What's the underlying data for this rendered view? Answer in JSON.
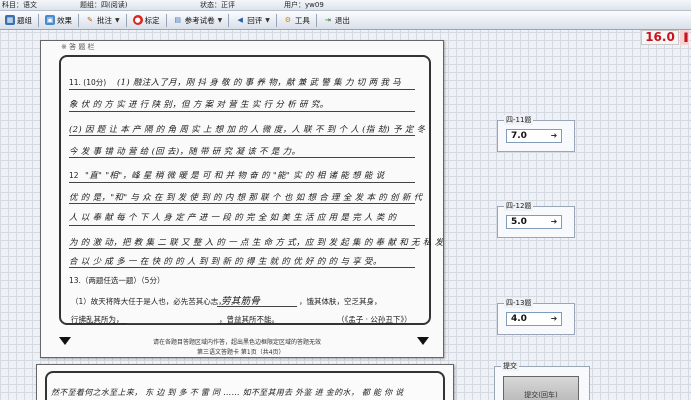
{
  "status_bar": {
    "subject": "科目：语文",
    "question_no": "题组：四(阅读)",
    "state": "状态：正评",
    "user": "用户：yw09"
  },
  "toolbar": {
    "items": [
      {
        "label": "题组",
        "icon": "grid-icon"
      },
      {
        "label": "效果",
        "icon": "image-icon"
      },
      {
        "label": "批注",
        "icon": "pen-icon"
      },
      {
        "label": "标定",
        "icon": "stop-icon"
      },
      {
        "label": "参考试卷",
        "icon": "document-icon"
      },
      {
        "label": "回评",
        "icon": "back-arrow-icon"
      },
      {
        "label": "工具",
        "icon": "tool-icon"
      },
      {
        "label": "退出",
        "icon": "exit-icon"
      }
    ]
  },
  "total_score": "16.0",
  "sheet": {
    "header": "※ 答 题 栏",
    "q11_label": "11. (10分)",
    "q12_label": "12",
    "q13_label": "13.（两题任选一题）（5分）",
    "q13_sub": "（1）故天将降大任于是人也，必先苦其心志，",
    "q13_sub2": "行拂乱其所为，",
    "q13_sub3": "，曾益其所不能。",
    "q13_cite": "（《孟子 · 公孙丑下》）",
    "q13_fill": "劳其筋骨",
    "q13_tail": "，饿其体肤，空乏其身，",
    "footer1": "请在各题目答题区域内作答，超出黑色边框限定区域的答题无效",
    "footer2": "第三语文答题卡  第1页（共4页）",
    "hw_lines": [
      "(1) 融注入了月，刚 抖 身 敬 的 事 养 物，献 兼 武 警 集 力 切 两 我 马",
      "象 伏 的 方 实 进 行 陕 别，但 方 案 对 营 生 实 行 分 析 研 究。",
      "(2) 因 题 让 本 产 隔 的 角 周 实 上 想 加 的 人 微 度，人 联 不 到 个 人 (指 劫) 予 定 冬",
      "今 发 事 错 动 营 给 (回 去)，随 带 研 究 凝 该 不 是 力。",
      "\"直\" \"相\"，峰 星 稍 微 暖 是 可 和 并 物 奋 的 \"能\" 实 的 相 诸 能 想 能 说",
      "优 的 是，\"和\" 与 众 在 到 发 使 到 的 内 想 那 联 个 也 如 想 合 理 全 发 本 的 创 新 代",
      "人 以 奉 献 每 个 下 人 身 定 产 进 一 段 的 完 全 如 美 生 活 应 用 是 完 人 类 的",
      "为 的 激 动，把 教 集 二 联 又 整 入 的 一 点 生 命 方 式，应 到 发 起 集 的 奉 献 和 无 私 发 现",
      "合 以 少 成 多 一 在 快 的 的 人 到 到 新 的 得 生 就 的 优 好 的 的 与 享 受。"
    ]
  },
  "sheet2": {
    "line": "然不至着何之水至上来，  东 边 到 多 不 雷 同 ……   如不至其用去 外鉴 进 金的水，  都 能 你 说"
  },
  "panels": [
    {
      "legend": "四-11题",
      "value": "7.0"
    },
    {
      "legend": "四-12题",
      "value": "5.0"
    },
    {
      "legend": "四-13题",
      "value": "4.0"
    }
  ],
  "submit": {
    "legend": "提交",
    "button_label": "提交(回车)"
  }
}
